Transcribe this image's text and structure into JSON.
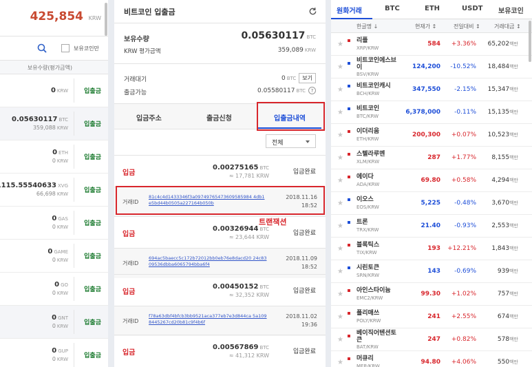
{
  "left": {
    "total_value": "425,854",
    "total_currency": "KRW",
    "hide_small_label": "보유코인만",
    "header_label": "보유수량(평가금액)",
    "rows": [
      {
        "amount": "0",
        "unit": "KRW",
        "krw": "",
        "krw_unit": "",
        "action": "입출금"
      },
      {
        "amount": "0.05630117",
        "unit": "BTC",
        "krw": "359,088",
        "krw_unit": "KRW",
        "action": "입출금"
      },
      {
        "amount": "0",
        "unit": "ETH",
        "krw": "0",
        "krw_unit": "KRW",
        "action": "입출금"
      },
      {
        "amount": ",115.55540633",
        "unit": "XVG",
        "krw": "66,698",
        "krw_unit": "KRW",
        "action": "입출금"
      },
      {
        "amount": "0",
        "unit": "GAS",
        "krw": "0",
        "krw_unit": "KRW",
        "action": "입출금"
      },
      {
        "amount": "0",
        "unit": "GAME",
        "krw": "0",
        "krw_unit": "KRW",
        "action": "입출금"
      },
      {
        "amount": "0",
        "unit": "GO",
        "krw": "0",
        "krw_unit": "KRW",
        "action": "입출금"
      },
      {
        "amount": "0",
        "unit": "GNT",
        "krw": "0",
        "krw_unit": "KRW",
        "action": "입출금"
      },
      {
        "amount": "0",
        "unit": "GUP",
        "krw": "0",
        "krw_unit": "KRW",
        "action": "입출금"
      }
    ]
  },
  "middle": {
    "title": "비트코인 입출금",
    "holding_label": "보유수량",
    "holding_value": "0.05630117",
    "holding_unit": "BTC",
    "krw_eval_label": "KRW 평가금액",
    "krw_eval_value": "359,089",
    "krw_eval_unit": "KRW",
    "pending_label": "거래대기",
    "pending_value": "0",
    "pending_unit": "BTC",
    "view_button": "보기",
    "withdrawable_label": "출금가능",
    "withdrawable_value": "0.05580117",
    "withdrawable_unit": "BTC",
    "help_icon": "?",
    "tabs": [
      "입금주소",
      "출금신청",
      "입출금내역"
    ],
    "filter_selected": "전체",
    "annotation": "트랜잭션",
    "history": [
      {
        "kind": "입금",
        "amount": "0.00275165",
        "unit": "BTC",
        "krw": "≈ 17,781",
        "krw_unit": "KRW",
        "status": "입금완료",
        "tid_label": "거래ID",
        "tid": "81c4c4d1433346f3a09749765473609585984 4db1e5bd44b0505a227164b050b",
        "date": "2018.11.16",
        "time": "18:52"
      },
      {
        "kind": "입금",
        "amount": "0.00326944",
        "unit": "BTC",
        "krw": "≈ 23,644",
        "krw_unit": "KRW",
        "status": "입금완료",
        "tid_label": "거래ID",
        "tid": "694ac5baecc5c172b72012bb0eb76e8dacd20 24c8309536dbba6065794bba6f4",
        "date": "2018.11.09",
        "time": "18:52"
      },
      {
        "kind": "입금",
        "amount": "0.00450152",
        "unit": "BTC",
        "krw": "≈ 32,352",
        "krw_unit": "KRW",
        "status": "입금완료",
        "tid_label": "거래ID",
        "tid": "f78a63dbf4bfcb3bb9521aca377eb7e3d844ca 5a1098445267cd20b81c9f4b6f",
        "date": "2018.11.02",
        "time": "19:36"
      },
      {
        "kind": "입금",
        "amount": "0.00567869",
        "unit": "BTC",
        "krw": "≈ 41,312",
        "krw_unit": "KRW",
        "status": "입금완료"
      }
    ]
  },
  "right": {
    "tabs": [
      "원화거래",
      "BTC",
      "ETH",
      "USDT",
      "보유코인"
    ],
    "headers": {
      "name": "한글명 ↓",
      "price": "현재가 ↕",
      "change": "전일대비 ↕",
      "volume": "거래대금 ↕"
    },
    "volume_unit": "백만",
    "colors": {
      "up": "#d8262c",
      "down": "#1d4ed8"
    },
    "coins": [
      {
        "name": "리플",
        "symbol": "XRP/KRW",
        "price": "584",
        "change": "+3.36%",
        "volume": "65,202",
        "dir": "up"
      },
      {
        "name": "비트코인에스브이",
        "symbol": "BSV/KRW",
        "price": "124,200",
        "change": "-10.52%",
        "volume": "18,484",
        "dir": "down"
      },
      {
        "name": "비트코인캐시",
        "symbol": "BCH/KRW",
        "price": "347,550",
        "change": "-2.15%",
        "volume": "15,347",
        "dir": "down"
      },
      {
        "name": "비트코인",
        "symbol": "BTC/KRW",
        "price": "6,378,000",
        "change": "-0.11%",
        "volume": "15,135",
        "dir": "down"
      },
      {
        "name": "이더리움",
        "symbol": "ETH/KRW",
        "price": "200,300",
        "change": "+0.07%",
        "volume": "10,523",
        "dir": "up"
      },
      {
        "name": "스텔라루멘",
        "symbol": "XLM/KRW",
        "price": "287",
        "change": "+1.77%",
        "volume": "8,155",
        "dir": "up"
      },
      {
        "name": "에이다",
        "symbol": "ADA/KRW",
        "price": "69.80",
        "change": "+0.58%",
        "volume": "4,294",
        "dir": "up"
      },
      {
        "name": "이오스",
        "symbol": "EOS/KRW",
        "price": "5,225",
        "change": "-0.48%",
        "volume": "3,670",
        "dir": "down"
      },
      {
        "name": "트론",
        "symbol": "TRX/KRW",
        "price": "21.40",
        "change": "-0.93%",
        "volume": "2,553",
        "dir": "down"
      },
      {
        "name": "블록틱스",
        "symbol": "TIX/KRW",
        "price": "193",
        "change": "+12.21%",
        "volume": "1,843",
        "dir": "up"
      },
      {
        "name": "시린토큰",
        "symbol": "SRN/KRW",
        "price": "143",
        "change": "-0.69%",
        "volume": "939",
        "dir": "down"
      },
      {
        "name": "아인스타이늄",
        "symbol": "EMC2/KRW",
        "price": "99.30",
        "change": "+1.02%",
        "volume": "757",
        "dir": "up"
      },
      {
        "name": "폴리매쓰",
        "symbol": "POLY/KRW",
        "price": "241",
        "change": "+2.55%",
        "volume": "674",
        "dir": "up"
      },
      {
        "name": "베이직어텐션토큰",
        "symbol": "BAT/KRW",
        "price": "247",
        "change": "+0.82%",
        "volume": "578",
        "dir": "up"
      },
      {
        "name": "머큐리",
        "symbol": "MER/KRW",
        "price": "94.80",
        "change": "+4.06%",
        "volume": "550",
        "dir": "up"
      }
    ]
  }
}
